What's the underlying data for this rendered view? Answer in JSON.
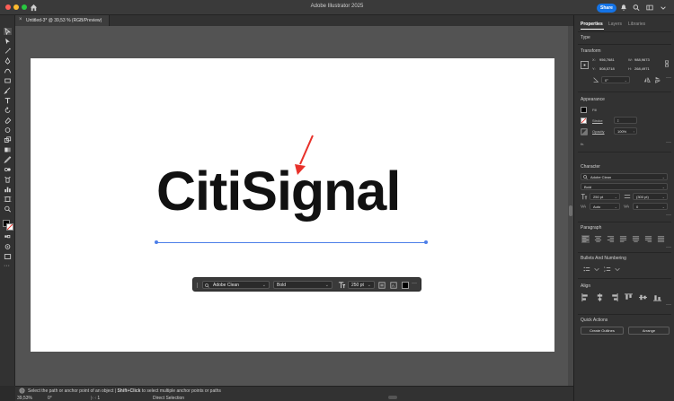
{
  "app": {
    "title": "Adobe Illustrator 2025",
    "share_label": "Share",
    "colors": {
      "close": "#ff5f57",
      "minimize": "#febc2e",
      "zoom": "#28c840",
      "share": "#1473e6",
      "selection": "#4c7ee8",
      "annotation_arrow": "#e8312a"
    }
  },
  "document_tab": {
    "label": "Untitled-3* @ 39,53 % (RGB/Preview)",
    "close_glyph": "×"
  },
  "artboard": {
    "headline": "CitiSignal"
  },
  "context_bar": {
    "font_family": "Adobe Clean",
    "font_style": "Bold",
    "font_size": "250 pt"
  },
  "panel": {
    "tabs": [
      "Properties",
      "Layers",
      "Libraries"
    ],
    "type_section": "Type",
    "transform": {
      "title": "Transform",
      "x_label": "X:",
      "x_value": "956,7681",
      "y_label": "Y:",
      "y_value": "508,5718",
      "w_label": "W:",
      "w_value": "988,9673",
      "h_label": "H:",
      "h_value": "268,4971",
      "rotation": "0°"
    },
    "appearance": {
      "title": "Appearance",
      "fill_label": "Fill",
      "stroke_label": "Stroke",
      "opacity_label": "Opacity",
      "opacity_value": "100%",
      "fx_label": "fx."
    },
    "character": {
      "title": "Character",
      "font_family": "Adobe Clean",
      "font_style": "Bold",
      "size": "250 pt",
      "leading": "(300 pt)",
      "kerning": "Auto",
      "tracking": "0"
    },
    "paragraph": {
      "title": "Paragraph"
    },
    "bullets": {
      "title": "Bullets And Numbering"
    },
    "align": {
      "title": "Align"
    },
    "quick_actions": {
      "title": "Quick Actions",
      "create_outlines": "Create Outlines",
      "arrange": "Arrange"
    }
  },
  "status": {
    "hint_part1": "Select the path or anchor point of an object",
    "hint_separator": "|",
    "hint_part2": "Shift+Click",
    "hint_part3": "to select multiple anchor points or paths",
    "zoom": "39,53%",
    "rotation": "0°",
    "artboard_number": "1",
    "tool_name": "Direct Selection"
  }
}
